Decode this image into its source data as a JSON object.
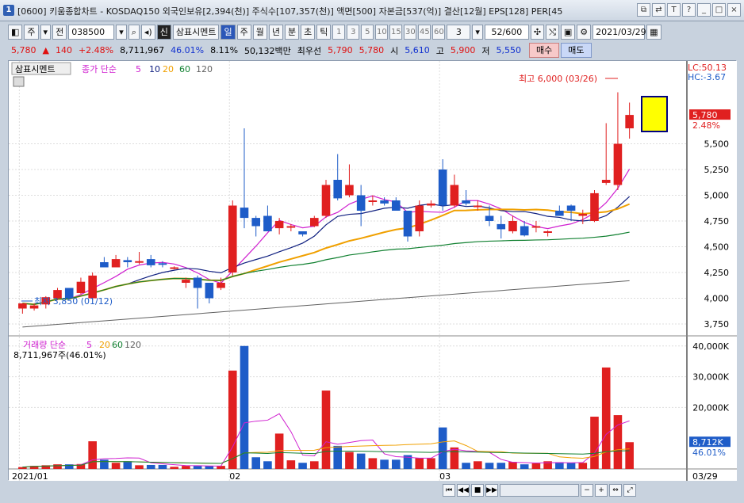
{
  "window": {
    "title": "[0600] 키움종합차트 - KOSDAQ150 외국인보유[2,394(천)] 주식수[107,357(천)] 액면[500] 자본금[537(억)] 결산[12월] EPS[128] PER[45"
  },
  "toolbar": {
    "market": "주",
    "mode": "전",
    "code": "038500",
    "chart_type": "삼표시멘트",
    "periods": [
      "일",
      "주",
      "월",
      "년",
      "분",
      "초",
      "틱"
    ],
    "numbers": [
      "1",
      "3",
      "5",
      "10",
      "15",
      "30",
      "45",
      "60"
    ],
    "period_count": "3",
    "count": "52/600",
    "date": "2021/03/29"
  },
  "quote": {
    "price": "5,780",
    "change": "140",
    "change_pct": "+2.48%",
    "volume": "8,711,967",
    "vol_ratio": "46.01%",
    "turnover": "8.11%",
    "amount": "50,132백만",
    "priority_label": "최우선",
    "ask": "5,790",
    "bid": "5,780",
    "open_label": "시",
    "open": "5,610",
    "high_label": "고",
    "high": "5,900",
    "low_label": "저",
    "low": "5,550",
    "buy": "매수",
    "sell": "매도"
  },
  "chart": {
    "legend_name": "삼표시멘트",
    "legend_series": "종가 단순",
    "ma_labels": [
      "5",
      "10",
      "20",
      "60",
      "120"
    ],
    "max_label": "최고 6,000 (03/26)",
    "min_label": "최저 3,850 (01/12)",
    "lc": "LC:50.13",
    "hc": "HC:-3.67",
    "current_tag": "5,780",
    "current_pct": "2.48%",
    "price_ticks": [
      "5,500",
      "5,250",
      "5,000",
      "4,750",
      "4,500",
      "4,250",
      "4,000",
      "3,750"
    ],
    "vol_legend": "거래량 단순",
    "vol_ma_labels": [
      "5",
      "20",
      "60",
      "120"
    ],
    "vol_value": "8,711,967주(46.01%)",
    "vol_ticks": [
      "40,000K",
      "30,000K",
      "20,000K"
    ],
    "vol_tag": "8,712K",
    "vol_pct": "46.01%",
    "x_labels": [
      "2021/01",
      "02",
      "03"
    ],
    "x_end": "03/29"
  },
  "chart_data": {
    "type": "candlestick",
    "ylim": [
      3650,
      6150
    ],
    "vol_max": 42000,
    "candles": [
      {
        "o": 3900,
        "h": 3950,
        "l": 3850,
        "c": 3950,
        "v": 600
      },
      {
        "o": 3900,
        "h": 3950,
        "l": 3880,
        "c": 3930,
        "v": 1000
      },
      {
        "o": 3940,
        "h": 4020,
        "l": 3900,
        "c": 4010,
        "v": 1200
      },
      {
        "o": 4000,
        "h": 4100,
        "l": 3980,
        "c": 4080,
        "v": 1500
      },
      {
        "o": 4100,
        "h": 4050,
        "l": 3990,
        "c": 4000,
        "v": 1500
      },
      {
        "o": 4050,
        "h": 4200,
        "l": 4040,
        "c": 4160,
        "v": 1600
      },
      {
        "o": 4000,
        "h": 4250,
        "l": 3980,
        "c": 4220,
        "v": 9000
      },
      {
        "o": 4350,
        "h": 4400,
        "l": 4300,
        "c": 4300,
        "v": 3000
      },
      {
        "o": 4300,
        "h": 4420,
        "l": 4300,
        "c": 4380,
        "v": 2000
      },
      {
        "o": 4370,
        "h": 4400,
        "l": 4300,
        "c": 4350,
        "v": 2500
      },
      {
        "o": 4350,
        "h": 4450,
        "l": 4330,
        "c": 4360,
        "v": 1200
      },
      {
        "o": 4380,
        "h": 4420,
        "l": 4300,
        "c": 4320,
        "v": 1300
      },
      {
        "o": 4340,
        "h": 4360,
        "l": 4300,
        "c": 4330,
        "v": 1300
      },
      {
        "o": 4300,
        "h": 4310,
        "l": 4280,
        "c": 4300,
        "v": 700
      },
      {
        "o": 4150,
        "h": 4200,
        "l": 4100,
        "c": 4180,
        "v": 1000
      },
      {
        "o": 4200,
        "h": 4220,
        "l": 3900,
        "c": 4100,
        "v": 1000
      },
      {
        "o": 4150,
        "h": 4150,
        "l": 3950,
        "c": 4000,
        "v": 900
      },
      {
        "o": 4100,
        "h": 4200,
        "l": 4080,
        "c": 4150,
        "v": 1000
      },
      {
        "o": 4250,
        "h": 4950,
        "l": 4220,
        "c": 4900,
        "v": 32000
      },
      {
        "o": 4880,
        "h": 5650,
        "l": 4680,
        "c": 4780,
        "v": 40000
      },
      {
        "o": 4780,
        "h": 4800,
        "l": 4600,
        "c": 4700,
        "v": 3800
      },
      {
        "o": 4800,
        "h": 4900,
        "l": 4650,
        "c": 4650,
        "v": 2500
      },
      {
        "o": 4680,
        "h": 4780,
        "l": 4620,
        "c": 4750,
        "v": 11500
      },
      {
        "o": 4700,
        "h": 4720,
        "l": 4650,
        "c": 4700,
        "v": 2800
      },
      {
        "o": 4650,
        "h": 4650,
        "l": 4600,
        "c": 4620,
        "v": 2000
      },
      {
        "o": 4700,
        "h": 4800,
        "l": 4690,
        "c": 4780,
        "v": 2500
      },
      {
        "o": 4800,
        "h": 5150,
        "l": 4780,
        "c": 5100,
        "v": 25500
      },
      {
        "o": 5150,
        "h": 5400,
        "l": 4950,
        "c": 4970,
        "v": 7500
      },
      {
        "o": 5000,
        "h": 5300,
        "l": 4980,
        "c": 5100,
        "v": 5500
      },
      {
        "o": 5000,
        "h": 5100,
        "l": 4700,
        "c": 4850,
        "v": 5000
      },
      {
        "o": 4950,
        "h": 5000,
        "l": 4900,
        "c": 4950,
        "v": 3500
      },
      {
        "o": 4950,
        "h": 4980,
        "l": 4900,
        "c": 4920,
        "v": 3000
      },
      {
        "o": 4950,
        "h": 4980,
        "l": 4850,
        "c": 4850,
        "v": 3000
      },
      {
        "o": 4850,
        "h": 4850,
        "l": 4550,
        "c": 4600,
        "v": 4500
      },
      {
        "o": 4650,
        "h": 4950,
        "l": 4600,
        "c": 4900,
        "v": 3500
      },
      {
        "o": 4900,
        "h": 4950,
        "l": 4880,
        "c": 4920,
        "v": 3500
      },
      {
        "o": 5250,
        "h": 5350,
        "l": 4850,
        "c": 4900,
        "v": 13500
      },
      {
        "o": 4900,
        "h": 5200,
        "l": 4880,
        "c": 5100,
        "v": 7000
      },
      {
        "o": 4950,
        "h": 5050,
        "l": 4900,
        "c": 4920,
        "v": 2000
      },
      {
        "o": 4900,
        "h": 4950,
        "l": 4850,
        "c": 4900,
        "v": 2500
      },
      {
        "o": 4800,
        "h": 4900,
        "l": 4700,
        "c": 4750,
        "v": 2000
      },
      {
        "o": 4720,
        "h": 4800,
        "l": 4580,
        "c": 4670,
        "v": 2000
      },
      {
        "o": 4650,
        "h": 4800,
        "l": 4630,
        "c": 4750,
        "v": 2300
      },
      {
        "o": 4700,
        "h": 4750,
        "l": 4600,
        "c": 4610,
        "v": 1500
      },
      {
        "o": 4700,
        "h": 4750,
        "l": 4640,
        "c": 4700,
        "v": 1800
      },
      {
        "o": 4650,
        "h": 4660,
        "l": 4600,
        "c": 4650,
        "v": 2500
      },
      {
        "o": 4850,
        "h": 4900,
        "l": 4850,
        "c": 4800,
        "v": 2200
      },
      {
        "o": 4900,
        "h": 4910,
        "l": 4750,
        "c": 4850,
        "v": 2000
      },
      {
        "o": 4800,
        "h": 4860,
        "l": 4720,
        "c": 4820,
        "v": 2000
      },
      {
        "o": 4750,
        "h": 5050,
        "l": 4740,
        "c": 5020,
        "v": 17000
      },
      {
        "o": 5120,
        "h": 5700,
        "l": 5100,
        "c": 5150,
        "v": 33000
      },
      {
        "o": 5100,
        "h": 6000,
        "l": 5050,
        "c": 5500,
        "v": 17500
      },
      {
        "o": 5650,
        "h": 5900,
        "l": 5550,
        "c": 5780,
        "v": 8700
      }
    ]
  },
  "colors": {
    "up": "#e02020",
    "down": "#1e5cc8",
    "ma5": "#d020d0",
    "ma10": "#102080",
    "ma20": "#f0a000",
    "ma60": "#108030",
    "ma120": "#606060"
  }
}
